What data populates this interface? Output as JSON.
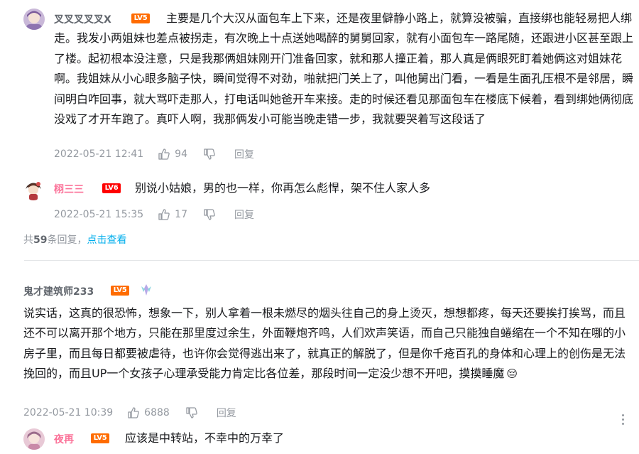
{
  "comments": {
    "c1": {
      "username": "叉叉叉叉叉X",
      "level": "LV5",
      "text": "主要是几个大汉从面包车上下来，还是夜里僻静小路上，就算没被骗，直接绑也能轻易把人绑走。我发小两姐妹也差点被拐走，有次晚上十点送她喝醉的舅舅回家，就有小面包车一路尾随，还跟进小区甚至跟上了楼。起初根本没注意，只是我那俩姐妹刚开门准备回家，就和那人撞正着，那人真是俩眼死盯着她俩这对姐妹花啊。我姐妹从小心眼多脑子快，瞬间觉得不对劲，啪就把门关上了，叫他舅出门看，一看是生面孔压根不是邻居，瞬间明白咋回事，就大骂吓走那人，打电话叫她爸开车来接。走的时候还看见那面包车在楼底下候着，看到绑她俩彻底没戏了才开车跑了。真吓人啊，我那俩发小可能当晚走错一步，我就要哭着写这段话了",
      "time": "2022-05-21 12:41",
      "likes": "94",
      "reply_label": "回复"
    },
    "c2": {
      "username": "栩三三",
      "level": "LV6",
      "text": "别说小姑娘，男的也一样，你再怎么彪悍，架不住人家人多",
      "time": "2022-05-21 15:35",
      "likes": "17",
      "reply_label": "回复"
    },
    "more": {
      "prefix": "共",
      "count": "59",
      "suffix": "条回复，",
      "link": "点击查看"
    },
    "c3": {
      "username": "鬼才建筑师233",
      "level": "LV5",
      "text": "说实话，这真的很恐怖，想象一下，别人拿着一根未燃尽的烟头往自己的身上烫灭，想想都疼，每天还要挨打挨骂，而且还不可以离开那个地方，只能在那里度过余生，外面鞭炮齐鸣，人们欢声笑语，而自己只能独自蜷缩在一个不知在哪的小房子里，而且每日都要被虐待，也许你会觉得逃出来了，就真正的解脱了，但是你千疮百孔的身体和心理上的创伤是无法挽回的，而且UP一个女孩子心理承受能力肯定比各位差，那段时间一定没少想不开吧，摸摸睡魔",
      "emoji": "😔",
      "time": "2022-05-21 10:39",
      "likes": "6888",
      "reply_label": "回复"
    },
    "c4": {
      "username": "夜再",
      "level": "LV5",
      "text": "应该是中转站，不幸中的万幸了"
    }
  },
  "colors": {
    "text": "#18191c",
    "meta": "#9499a0",
    "username": "#61666d",
    "vip_pink": "#fb7299",
    "link_blue": "#00aeec",
    "lv5": "#ff6c00",
    "lv6": "#ff0000"
  }
}
